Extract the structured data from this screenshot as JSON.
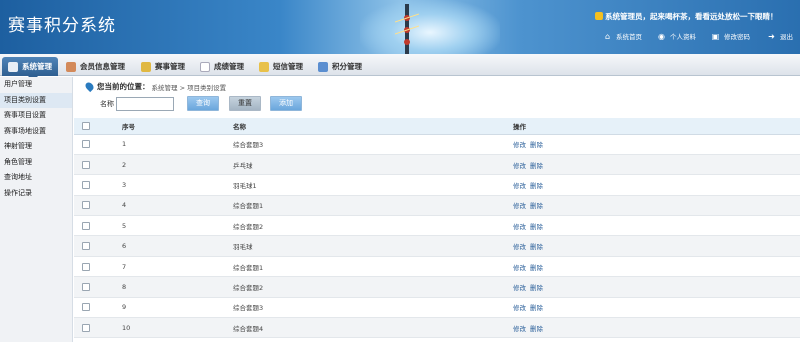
{
  "app_title": "赛事积分系统",
  "welcome_text": "系统管理员，起来喝杯茶，看看远处放松一下眼睛！",
  "top_links": [
    {
      "label": "系统首页",
      "icon": "home-icon"
    },
    {
      "label": "个人资料",
      "icon": "user-card-icon"
    },
    {
      "label": "修改密码",
      "icon": "lock-icon"
    },
    {
      "label": "退出",
      "icon": "exit-arrow-icon"
    }
  ],
  "nav_tabs": [
    {
      "label": "系统管理",
      "icon": "document-edit-icon",
      "color": "#e8eef5",
      "active": true
    },
    {
      "label": "会员信息管理",
      "icon": "member-icon",
      "color": "#d38a5a"
    },
    {
      "label": "赛事管理",
      "icon": "event-icon",
      "color": "#e0b842"
    },
    {
      "label": "成绩管理",
      "icon": "score-icon",
      "color": "#ffffff"
    },
    {
      "label": "短信管理",
      "icon": "sms-icon",
      "color": "#e8c14a"
    },
    {
      "label": "积分管理",
      "icon": "chart-icon",
      "color": "#5a8ed0"
    }
  ],
  "sidebar_items": [
    {
      "label": "用户管理"
    },
    {
      "label": "项目类别设置",
      "active": true
    },
    {
      "label": "赛事项目设置"
    },
    {
      "label": "赛事场地设置"
    },
    {
      "label": "神射管理"
    },
    {
      "label": "角色管理"
    },
    {
      "label": "查询地址"
    },
    {
      "label": "操作记录"
    }
  ],
  "breadcrumb": {
    "lead": "您当前的位置：",
    "path": "系统管理 > 项目类别设置"
  },
  "filter": {
    "name_label": "名称",
    "name_value": "",
    "search_label": "查询",
    "reset_label": "重置",
    "add_label": "添加"
  },
  "table": {
    "headers": [
      "",
      "序号",
      "名称",
      "操作"
    ],
    "edit_label": "修改",
    "delete_label": "删除",
    "rows": [
      {
        "no": "1",
        "name": "综合套题3"
      },
      {
        "no": "2",
        "name": "乒乓球"
      },
      {
        "no": "3",
        "name": "羽毛球1"
      },
      {
        "no": "4",
        "name": "综合套题1"
      },
      {
        "no": "5",
        "name": "综合套题2"
      },
      {
        "no": "6",
        "name": "羽毛球"
      },
      {
        "no": "7",
        "name": "综合套题1"
      },
      {
        "no": "8",
        "name": "综合套题2"
      },
      {
        "no": "9",
        "name": "综合套题3"
      },
      {
        "no": "10",
        "name": "综合套题4"
      }
    ]
  }
}
